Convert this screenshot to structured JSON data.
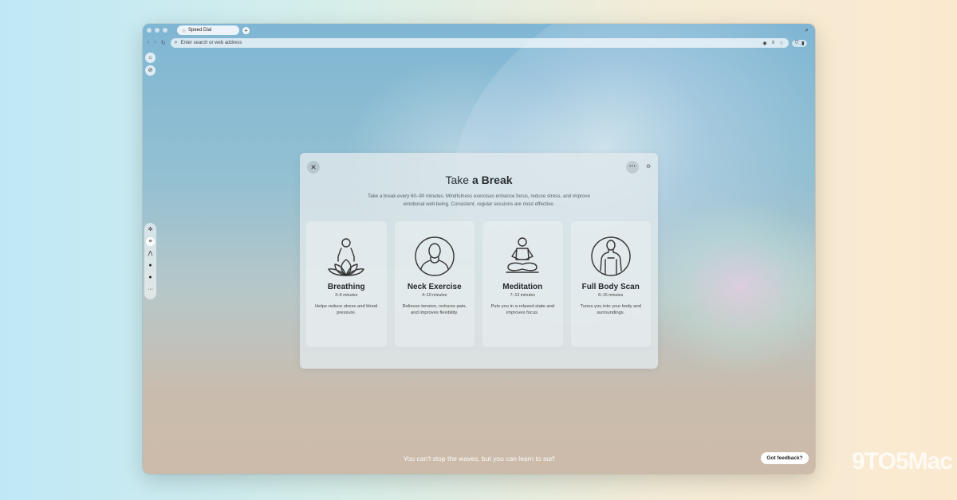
{
  "watermark": "9TO5Mac",
  "browser": {
    "tab_title": "Speed Dial",
    "new_tab_label": "+",
    "address_placeholder": "Enter search or web address"
  },
  "break_panel": {
    "title_light": "Take ",
    "title_bold": "a Break",
    "subtitle": "Take a break every 60–90 minutes. Mindfulness exercises enhance focus, reduce stress, and improve emotional well-being. Consistent, regular sessions are most effective.",
    "close_label": "✕",
    "more_label": "···",
    "exercises": [
      {
        "name": "Breathing",
        "duration": "3–6 minutes",
        "desc": "Helps reduce stress and blood pressure.",
        "icon": "lotus-figure-icon"
      },
      {
        "name": "Neck Exercise",
        "duration": "4–10 minutes",
        "desc": "Relieves tension, reduces pain, and improves flexibility.",
        "icon": "neck-figure-icon"
      },
      {
        "name": "Meditation",
        "duration": "7–13 minutes",
        "desc": "Puts you in a relaxed state and improves focus.",
        "icon": "meditation-figure-icon"
      },
      {
        "name": "Full Body Scan",
        "duration": "8–15 minutes",
        "desc": "Tunes you into your body and surroundings.",
        "icon": "body-scan-figure-icon"
      }
    ]
  },
  "quote": "You can't stop the waves, but you can learn to surf",
  "feedback_label": "Got feedback?"
}
